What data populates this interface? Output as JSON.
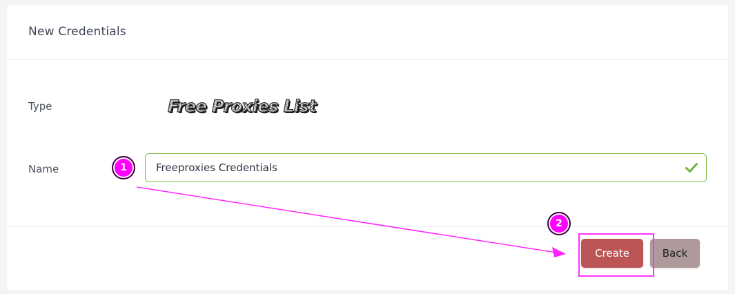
{
  "card": {
    "title": "New Credentials"
  },
  "form": {
    "type_label": "Type",
    "type_logo_text": "Free Proxies List",
    "name_label": "Name",
    "name_value": "Freeproxies Credentials"
  },
  "actions": {
    "create_label": "Create",
    "back_label": "Back"
  },
  "annotations": {
    "marker_1": "1",
    "marker_2": "2",
    "color": "#ff00ff"
  },
  "colors": {
    "create_button": "#bc5556",
    "back_button": "#ae9a9a",
    "valid_border": "#7cbf48"
  },
  "icons": {
    "valid": "check-icon"
  }
}
